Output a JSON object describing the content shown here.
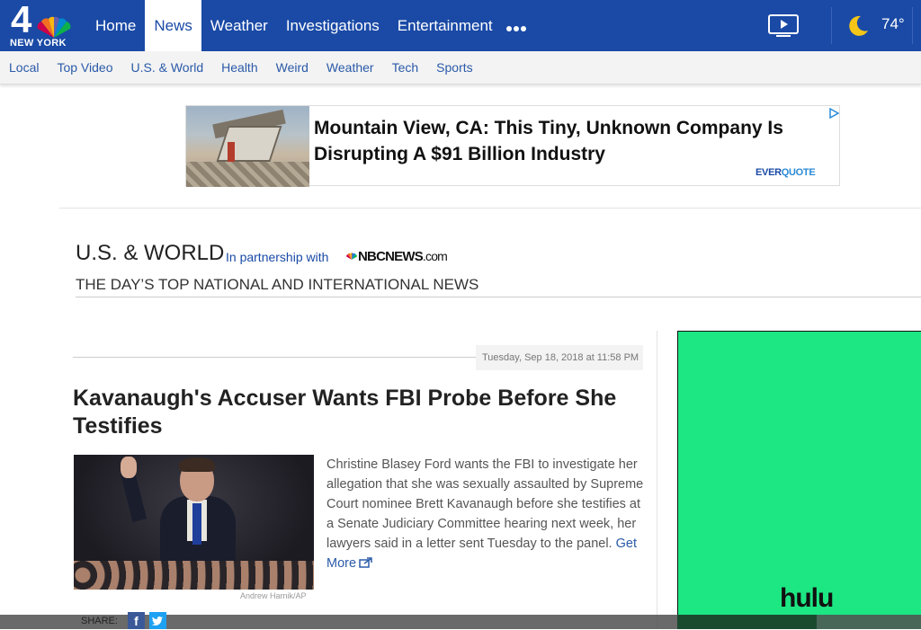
{
  "header": {
    "logo_city": "NEW YORK",
    "logo_number": "4",
    "nav": [
      {
        "label": "Home",
        "active": false
      },
      {
        "label": "News",
        "active": true
      },
      {
        "label": "Weather",
        "active": false
      },
      {
        "label": "Investigations",
        "active": false
      },
      {
        "label": "Entertainment",
        "active": false
      }
    ],
    "more_icon": "more-dots-icon",
    "video_icon": "tv-play-icon",
    "weather_icon": "moon-icon",
    "temperature": "74°"
  },
  "subnav": [
    "Local",
    "Top Video",
    "U.S. & World",
    "Health",
    "Weird",
    "Weather",
    "Tech",
    "Sports"
  ],
  "ad_banner": {
    "headline": "Mountain View, CA: This Tiny, Unknown Company Is Disrupting A $91 Billion Industry",
    "brand_a": "EVER",
    "brand_b": "QUOTE",
    "choice_icon": "ad-choices-icon"
  },
  "section": {
    "title": "U.S. & WORLD",
    "partner_text": "In partnership with",
    "partner_logo_a": "NBCNEWS",
    "partner_logo_b": ".com",
    "subtitle": "THE DAY’S TOP NATIONAL AND INTERNATIONAL NEWS"
  },
  "article": {
    "date": "Tuesday, Sep 18, 2018 at 11:58 PM",
    "headline": "Kavanaugh's Accuser Wants FBI Probe Before She Testifies",
    "summary": "Christine Blasey Ford wants the FBI to investigate her allegation that she was sexually assaulted by Supreme Court nominee Brett Kavanaugh before she testifies at a Senate Judiciary Committee hearing next week, her lawyers said in a letter sent Tuesday to the panel.",
    "get_more": "Get More",
    "photo_credit": "Andrew Harnik/AP",
    "share_label": "SHARE:",
    "share_fb": "f"
  },
  "side_ad": {
    "brand": "hulu",
    "bg_color": "#1ce783"
  },
  "colors": {
    "brand_blue": "#1a4aa6",
    "link_blue": "#2a5aa8"
  }
}
